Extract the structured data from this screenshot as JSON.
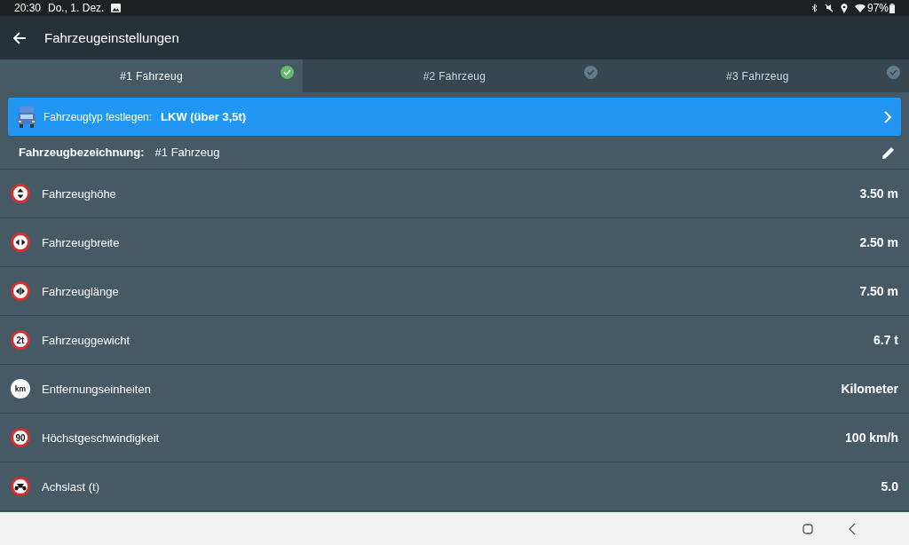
{
  "status_bar": {
    "time": "20:30",
    "date": "Do., 1. Dez.",
    "battery": "97%"
  },
  "app_bar": {
    "title": "Fahrzeugeinstellungen"
  },
  "tabs": [
    {
      "label": "#1 Fahrzeug",
      "selected": true
    },
    {
      "label": "#2 Fahrzeug",
      "selected": false
    },
    {
      "label": "#3 Fahrzeug",
      "selected": false
    }
  ],
  "vehicle_type": {
    "label": "Fahrzeugtyp festlegen:",
    "value": "LKW (über 3,5t)"
  },
  "vehicle_name": {
    "label": "Fahrzeugbezeichnung:",
    "value": "#1 Fahrzeug"
  },
  "settings": [
    {
      "kind": "height",
      "label": "Fahrzeughöhe",
      "value": "3.50 m"
    },
    {
      "kind": "width",
      "label": "Fahrzeugbreite",
      "value": "2.50 m"
    },
    {
      "kind": "length",
      "label": "Fahrzeuglänge",
      "value": "7.50 m"
    },
    {
      "kind": "text-sign",
      "sign_text": "2t",
      "label": "Fahrzeuggewicht",
      "value": "6.7 t"
    },
    {
      "kind": "unit",
      "sign_text": "km",
      "label": "Entfernungseinheiten",
      "value": "Kilometer"
    },
    {
      "kind": "text-sign",
      "sign_text": "90",
      "label": "Höchstgeschwindigkeit",
      "value": "100 km/h"
    },
    {
      "kind": "axle",
      "label": "Achslast (t)",
      "value": "5.0"
    }
  ]
}
